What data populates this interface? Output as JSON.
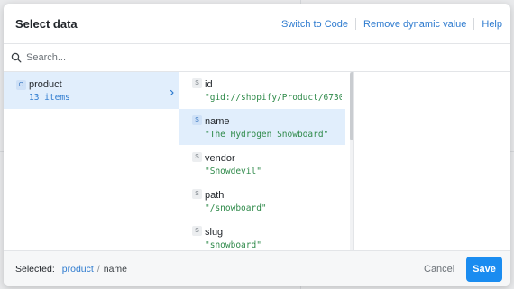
{
  "modal": {
    "title": "Select data",
    "actions": {
      "switch_to_code": "Switch to Code",
      "remove_dynamic_value": "Remove dynamic value",
      "help": "Help"
    }
  },
  "search": {
    "placeholder": "Search...",
    "value": ""
  },
  "pane1": {
    "items": [
      {
        "badge": "O",
        "name": "product",
        "count": "13 items",
        "selected": true
      }
    ]
  },
  "pane2": {
    "items": [
      {
        "badge": "S",
        "key": "id",
        "value": "\"gid://shopify/Product/67308…",
        "selected": false
      },
      {
        "badge": "S",
        "key": "name",
        "value": "\"The Hydrogen Snowboard\"",
        "selected": true
      },
      {
        "badge": "S",
        "key": "vendor",
        "value": "\"Snowdevil\"",
        "selected": false
      },
      {
        "badge": "S",
        "key": "path",
        "value": "\"/snowboard\"",
        "selected": false
      },
      {
        "badge": "S",
        "key": "slug",
        "value": "\"snowboard\"",
        "selected": false
      }
    ],
    "scroll_fraction_visible": 0.38
  },
  "footer": {
    "selected_label": "Selected:",
    "path": [
      "product",
      "name"
    ],
    "cancel_label": "Cancel",
    "save_label": "Save"
  },
  "colors": {
    "accent": "#1a8cf0",
    "link": "#2e7bcf",
    "selected_row": "#e1eefc",
    "string_value": "#2f8a4a"
  }
}
